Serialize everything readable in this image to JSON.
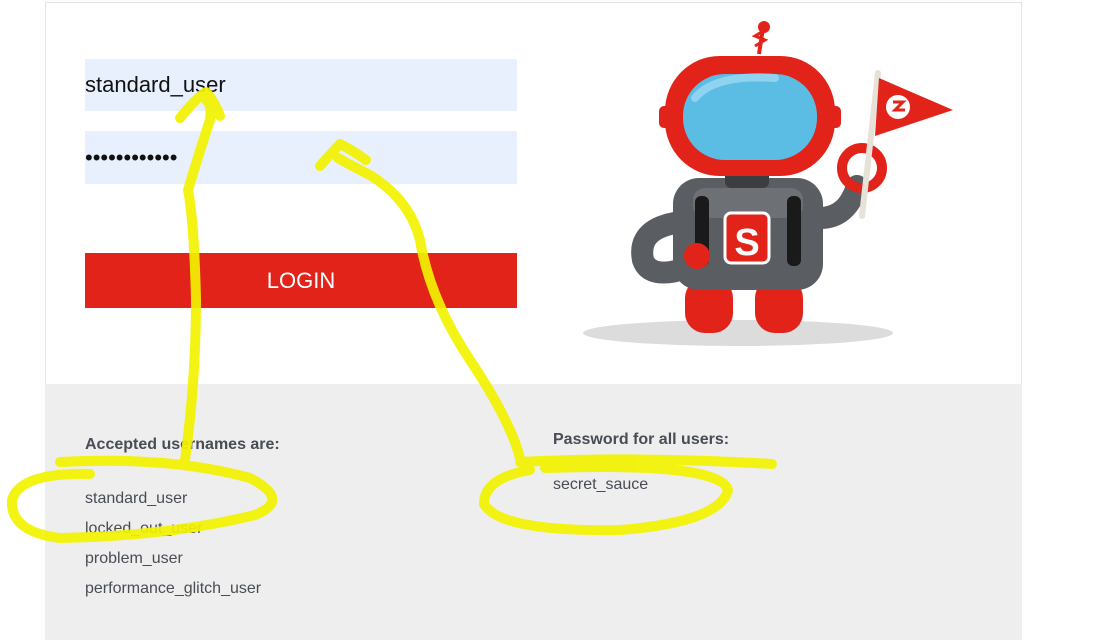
{
  "login_form": {
    "username_value": "standard_user",
    "password_value": "••••••••••••",
    "login_label": "LOGIN"
  },
  "credentials": {
    "usernames_heading": "Accepted usernames are:",
    "usernames": [
      "standard_user",
      "locked_out_user",
      "problem_user",
      "performance_glitch_user"
    ],
    "password_heading": "Password for all users:",
    "password": "secret_sauce"
  },
  "colors": {
    "accent": "#e2231a",
    "input_bg": "#e8f0fe",
    "panel_bg": "#eeeeee",
    "highlighter": "#f2f200"
  },
  "icons": {
    "mascot": "robot-mascot-icon",
    "flag": "pennant-flag-icon"
  }
}
